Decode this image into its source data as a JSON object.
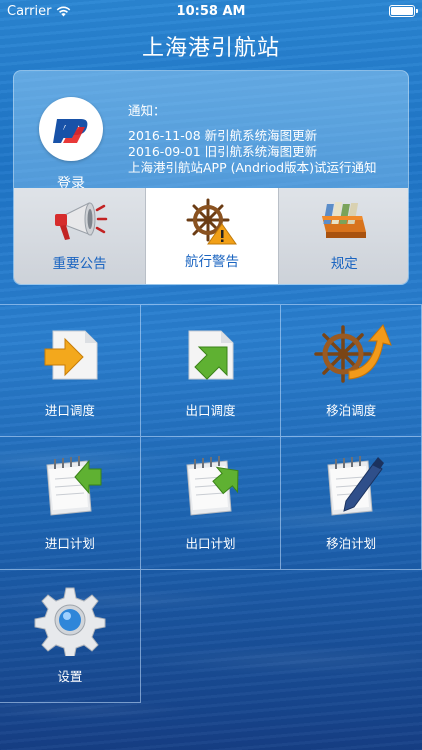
{
  "status_bar": {
    "carrier": "Carrier",
    "time": "10:58 AM"
  },
  "header": {
    "title": "上海港引航站"
  },
  "login": {
    "label": "登录"
  },
  "notice": {
    "title": "通知：",
    "items": [
      "2016-11-08 新引航系统海图更新",
      "2016-09-01 旧引航系统海图更新",
      "上海港引航站APP (Andriod版本)试运行通知"
    ]
  },
  "tabs": [
    {
      "label": "重要公告",
      "icon": "megaphone-icon"
    },
    {
      "label": "航行警告",
      "icon": "ship-wheel-warning-icon",
      "active": true
    },
    {
      "label": "规定",
      "icon": "file-box-icon"
    }
  ],
  "grid": [
    {
      "label": "进口调度",
      "icon": "import-arrow-icon"
    },
    {
      "label": "出口调度",
      "icon": "export-arrow-icon"
    },
    {
      "label": "移泊调度",
      "icon": "ship-wheel-arrow-icon"
    },
    {
      "label": "进口计划",
      "icon": "notepad-import-icon"
    },
    {
      "label": "出口计划",
      "icon": "notepad-export-icon"
    },
    {
      "label": "移泊计划",
      "icon": "notepad-pen-icon"
    },
    {
      "label": "设置",
      "icon": "gear-icon"
    }
  ],
  "colors": {
    "tab_text": "#1a64c0",
    "background": "#1f76c8"
  }
}
